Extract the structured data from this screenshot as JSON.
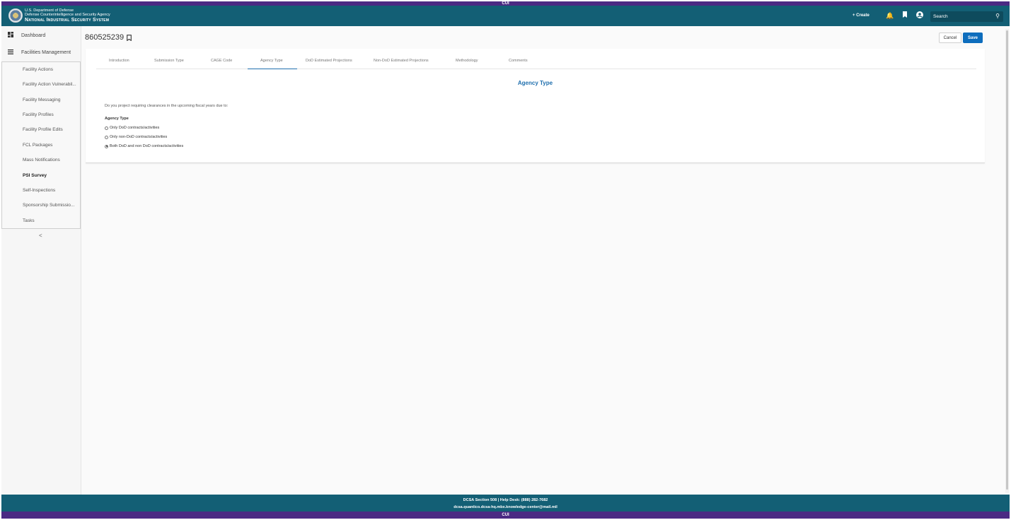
{
  "cui": {
    "top": "CUI",
    "bottom": "CUI"
  },
  "header": {
    "agency_line1": "U.S. Department of Defense",
    "agency_line2": "Defense Counterintelligence and Security Agency",
    "system_name": "National Industrial Security System",
    "create_label": "+ Create",
    "search_placeholder": "Search",
    "icons": [
      "bell-icon",
      "bookmark-icon",
      "account-icon",
      "search-icon"
    ]
  },
  "sidebar": {
    "dashboard_label": "Dashboard",
    "facilities_label": "Facilities Management",
    "items": [
      {
        "label": "Facility Actions"
      },
      {
        "label": "Facility Action Vulnerabil..."
      },
      {
        "label": "Facility Messaging"
      },
      {
        "label": "Facility Profiles"
      },
      {
        "label": "Facility Profile Edits"
      },
      {
        "label": "FCL Packages"
      },
      {
        "label": "Mass Notifications"
      },
      {
        "label": "PSI Survey",
        "active": true
      },
      {
        "label": "Self-Inspections"
      },
      {
        "label": "Sponsorship Submissio..."
      },
      {
        "label": "Tasks"
      }
    ],
    "collapse_label": "<"
  },
  "record": {
    "id": "860525239"
  },
  "actions": {
    "cancel_label": "Cancel",
    "save_label": "Save"
  },
  "tabs": [
    {
      "label": "Introduction"
    },
    {
      "label": "Submission Type"
    },
    {
      "label": "CAGE Code"
    },
    {
      "label": "Agency Type",
      "active": true
    },
    {
      "label": "DoD Estimated Projections"
    },
    {
      "label": "Non-DoD Estimated Projections"
    },
    {
      "label": "Methodology"
    },
    {
      "label": "Comments"
    }
  ],
  "form": {
    "title": "Agency Type",
    "question": "Do you project requiring clearances in the upcoming fiscal years due to:",
    "group_label": "Agency Type",
    "options": [
      {
        "label": "Only DoD contracts/activities",
        "checked": false
      },
      {
        "label": "Only non-DoD contracts/activities",
        "checked": false
      },
      {
        "label": "Both DoD and non DoD contracts/activities",
        "checked": true
      }
    ]
  },
  "footer": {
    "line1": "DCSA Section 508 | Help Desk: (888) 282-7682",
    "line2": "dcsa.quantico.dcsa-hq.mbx.knowledge-center@mail.mil"
  },
  "colors": {
    "header": "#135f75",
    "cui": "#4b2a83",
    "accent": "#1f6fae",
    "save": "#0d6dbd"
  }
}
